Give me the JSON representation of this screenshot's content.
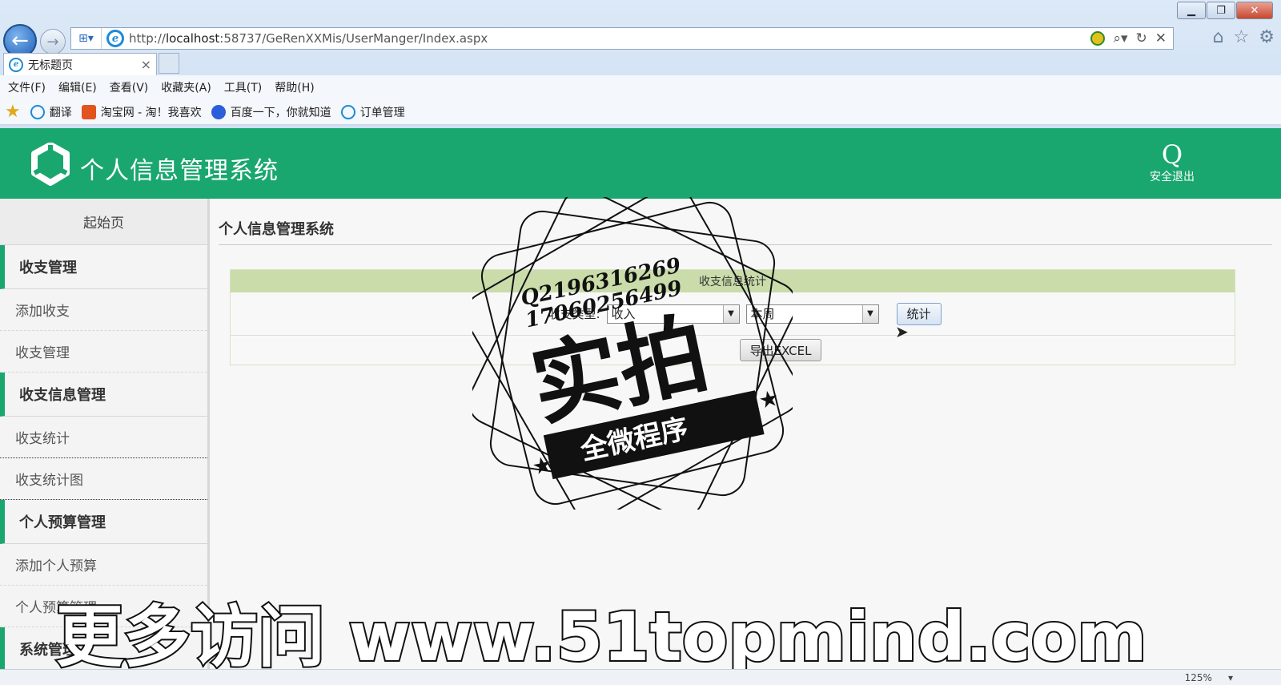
{
  "browser": {
    "url_prefix": "http://",
    "url_host": "localhost",
    "url_rest": ":58737/GeRenXXMis/UserManger/Index.aspx",
    "tab_title": "无标题页",
    "menu": [
      "文件(F)",
      "编辑(E)",
      "查看(V)",
      "收藏夹(A)",
      "工具(T)",
      "帮助(H)"
    ],
    "favorites": [
      "翻译",
      "淘宝网 - 淘！我喜欢",
      "百度一下，你就知道",
      "订单管理"
    ],
    "zoom": "125%"
  },
  "header": {
    "title": "个人信息管理系统",
    "logout_label": "安全退出",
    "logout_icon": "Q"
  },
  "sidebar": {
    "home": "起始页",
    "groups": [
      {
        "label": "收支管理",
        "items": [
          "添加收支",
          "收支管理"
        ]
      },
      {
        "label": "收支信息管理",
        "items": [
          "收支统计",
          "收支统计图"
        ]
      },
      {
        "label": "个人预算管理",
        "items": [
          "添加个人预算",
          "个人预算管理"
        ]
      },
      {
        "label": "系统管理",
        "items": []
      }
    ]
  },
  "main": {
    "page_title": "个人信息管理系统",
    "panel_title": "收支信息统计",
    "type_label": "收支类型:",
    "type_value": "收入",
    "period_value": "本周",
    "stat_button": "统计",
    "export_button": "导出EXCEL"
  },
  "watermark": {
    "qq": "Q2196316269",
    "phone": "17060256499",
    "stamp_big": "实拍",
    "stamp_ribbon": "全微程序",
    "bottom_text": "更多访问 www.51topmind.com"
  },
  "colors": {
    "header_green": "#1aa76f",
    "panel_head": "#c9dca9",
    "sidebar_accent": "#1aa76f"
  }
}
